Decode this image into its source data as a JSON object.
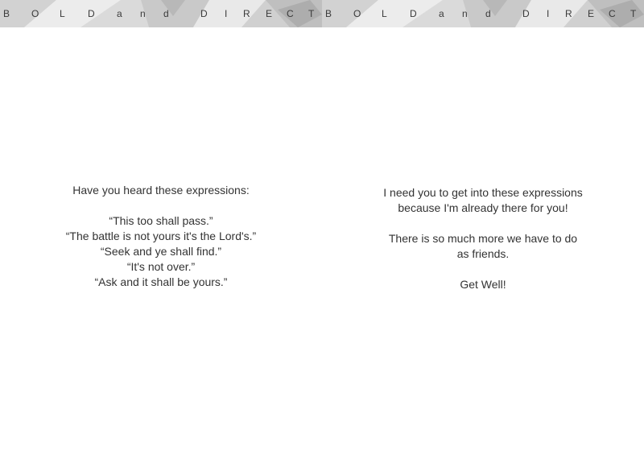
{
  "banner": {
    "letters": [
      "B",
      "O",
      "L",
      "D",
      "a",
      "n",
      "d",
      "D",
      "I",
      "R",
      "E",
      "C",
      "T"
    ]
  },
  "left_page": {
    "intro": "Have you heard these expressions:",
    "quotes": [
      "“This too shall pass.”",
      "“The battle is not yours it's the Lord's.”",
      "“Seek and ye shall find.”",
      "“It's not over.”",
      "“Ask and it shall be yours.”"
    ]
  },
  "right_page": {
    "paragraph1": [
      "I need you to get into these expressions",
      "because I'm already there for you!"
    ],
    "paragraph2": [
      "There is so much more we have to do",
      "as friends."
    ],
    "closing": "Get Well!"
  }
}
